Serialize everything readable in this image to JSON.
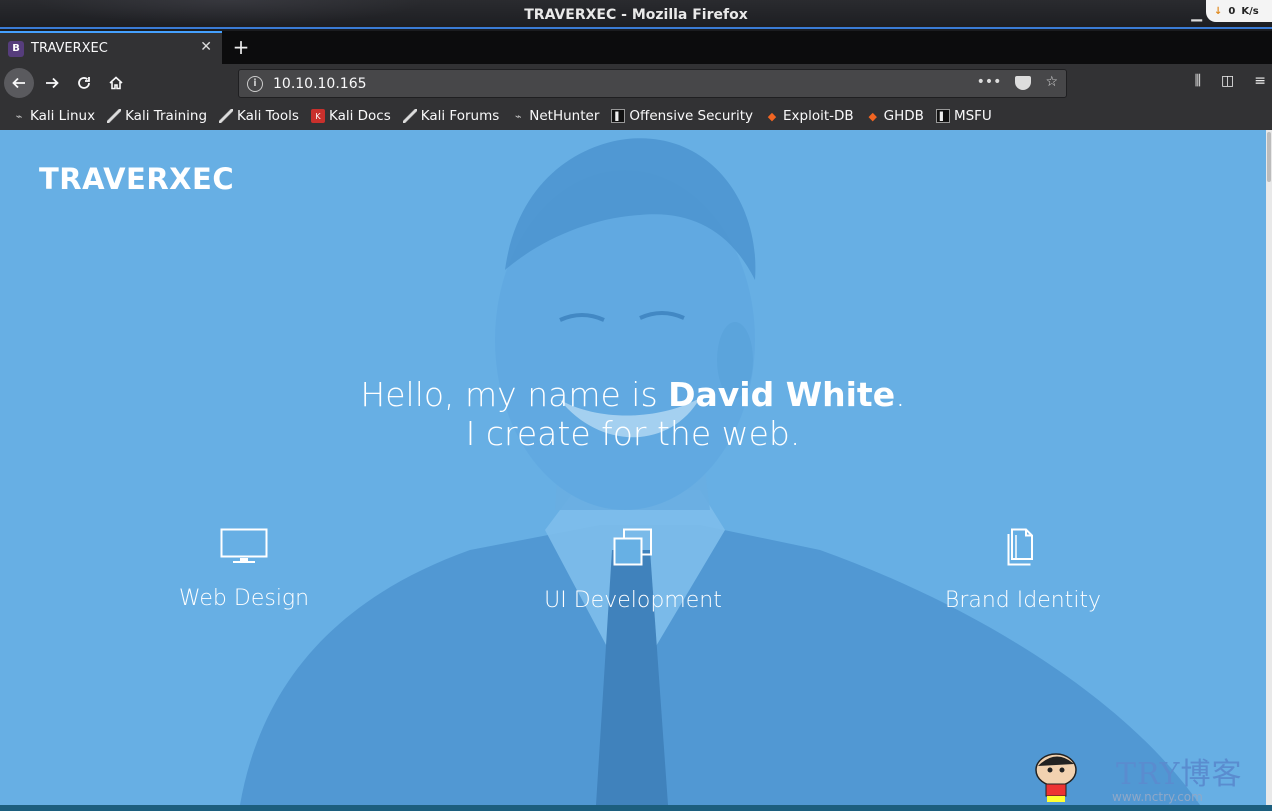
{
  "window": {
    "title": "TRAVERXEC - Mozilla Firefox",
    "net_speed": "0",
    "net_unit": "K/s"
  },
  "tabs": [
    {
      "label": "TRAVERXEC",
      "favicon": "B"
    }
  ],
  "urlbar": {
    "url": "10.10.10.165"
  },
  "bookmarks": [
    {
      "label": "Kali Linux",
      "icon": "kali-icon"
    },
    {
      "label": "Kali Training",
      "icon": "kali-dragon-icon"
    },
    {
      "label": "Kali Tools",
      "icon": "kali-dragon-icon"
    },
    {
      "label": "Kali Docs",
      "icon": "kali-docs-icon"
    },
    {
      "label": "Kali Forums",
      "icon": "kali-dragon-icon"
    },
    {
      "label": "NetHunter",
      "icon": "kali-icon"
    },
    {
      "label": "Offensive Security",
      "icon": "offsec-icon"
    },
    {
      "label": "Exploit-DB",
      "icon": "exploitdb-icon"
    },
    {
      "label": "GHDB",
      "icon": "exploitdb-icon"
    },
    {
      "label": "MSFU",
      "icon": "offsec-icon"
    }
  ],
  "page": {
    "brand": "TRAVERXEC",
    "hero_line1_prefix": "Hello, my name is ",
    "hero_name": "David White",
    "hero_line1_suffix": ".",
    "hero_line2": "I create for the web.",
    "services": [
      {
        "label": "Web Design",
        "icon": "monitor-icon"
      },
      {
        "label": "UI Development",
        "icon": "stacked-windows-icon"
      },
      {
        "label": "Brand Identity",
        "icon": "documents-icon"
      }
    ],
    "background_color": "#67b0e4"
  },
  "watermark": {
    "text": "TRY博客",
    "url": "www.nctry.com"
  }
}
